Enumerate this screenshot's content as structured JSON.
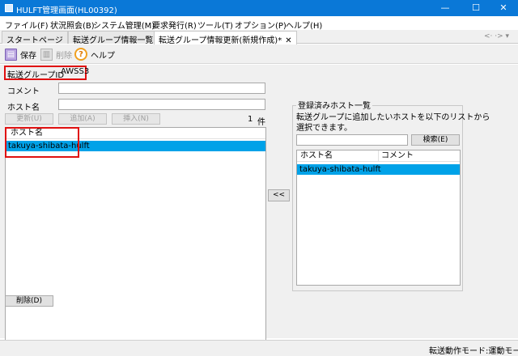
{
  "window": {
    "title": "HULFT管理画面(HL00392)",
    "minimize": "—",
    "maximize": "☐",
    "close": "✕"
  },
  "menu": [
    "ファイル(F)",
    "状況照会(B)",
    "システム管理(M)",
    "要求発行(R)",
    "ツール(T)",
    "オプション(P)",
    "ヘルプ(H)"
  ],
  "tabs": [
    {
      "label": "スタートページ",
      "active": false
    },
    {
      "label": "転送グループ情報一覧",
      "active": false
    },
    {
      "label": "転送グループ情報更新(新規作成)*",
      "active": true
    }
  ],
  "tab_close": "✕",
  "tab_nav": "<· ·> ▾",
  "toolbar": {
    "save": "保存",
    "delete": "削除",
    "help": "ヘルプ",
    "help_icon_glyph": "?"
  },
  "form": {
    "group_id_label": "転送グループID",
    "group_id_value": "AWSS3",
    "comment_label": "コメント",
    "comment_value": "",
    "host_label": "ホスト名",
    "host_value": "",
    "update_button": "更新(U)",
    "add_button": "追加(A)",
    "insert_button": "挿入(N)",
    "count": "1",
    "count_unit": "件",
    "list_header": "ホスト名",
    "hosts": [
      "takuya-shibata-hulft"
    ],
    "delete_button": "削除(D)",
    "move_button": "<<"
  },
  "registered": {
    "title": "登録済みホスト一覧",
    "description_line1": "転送グループに追加したいホストを以下のリストから",
    "description_line2": "選択できます。",
    "search_value": "",
    "search_button": "検索(E)",
    "col_host": "ホスト名",
    "col_comment": "コメント",
    "rows": [
      {
        "host": "takuya-shibata-hulft",
        "comment": ""
      }
    ]
  },
  "status": {
    "mode": "転送動作モード:運動モード"
  },
  "colors": {
    "titlebar": "#0a78d7",
    "selection": "#00a2e8",
    "highlight": "#e01010"
  }
}
